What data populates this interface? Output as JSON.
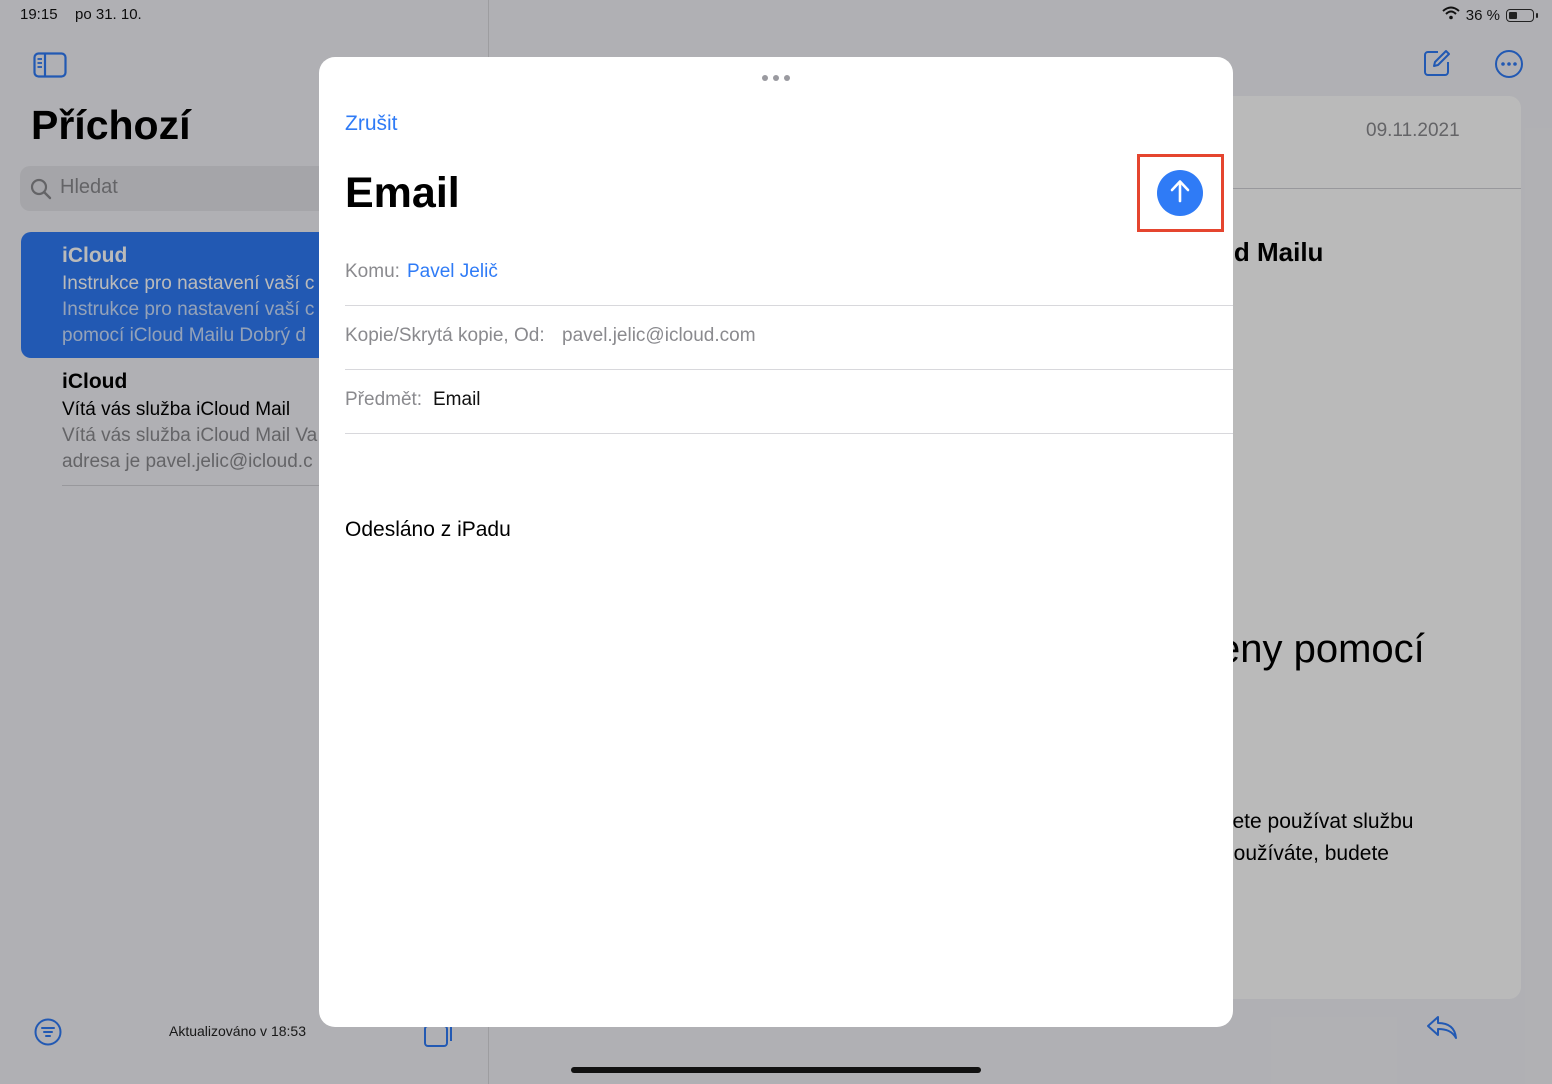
{
  "status": {
    "time": "19:15",
    "date": "po 31. 10.",
    "battery": "36 %",
    "battery_level": 0.36
  },
  "mailbox": {
    "title": "Příchozí",
    "search_placeholder": "Hledat",
    "messages": [
      {
        "sender": "iCloud",
        "subject": "Instrukce pro nastavení vaší c",
        "preview_line1": "Instrukce pro nastavení vaší c",
        "preview_line2": "pomocí iCloud Mailu Dobrý d",
        "selected": true
      },
      {
        "sender": "iCloud",
        "subject": "Vítá vás služba iCloud Mail",
        "preview_line1": "Vítá vás služba iCloud Mail Va",
        "preview_line2": "adresa je pavel.jelic@icloud.c",
        "selected": false
      }
    ],
    "updated": "Aktualizováno v 18:53"
  },
  "reader": {
    "date": "09.11.2021",
    "heading_fragment": "ud Mailu",
    "big_fragment": "eny pomocí",
    "body_line1": "žete používat službu",
    "body_line2": "používáte, budete"
  },
  "compose": {
    "cancel_label": "Zrušit",
    "title": "Email",
    "to_label": "Komu:",
    "to_value": "Pavel Jelič",
    "cc_label": "Kopie/Skrytá kopie, Od:",
    "cc_value": "pavel.jelic@icloud.com",
    "subject_label": "Předmět:",
    "subject_value": "Email",
    "body": "Odesláno z iPadu"
  },
  "colors": {
    "accent": "#2f7bf6",
    "highlight": "#e5452f"
  },
  "icons": [
    "sidebar-icon",
    "search-icon",
    "filter-icon",
    "stack-icon",
    "compose-icon",
    "more-icon",
    "reply-icon",
    "send-arrow-icon",
    "wifi-icon",
    "battery-icon"
  ]
}
